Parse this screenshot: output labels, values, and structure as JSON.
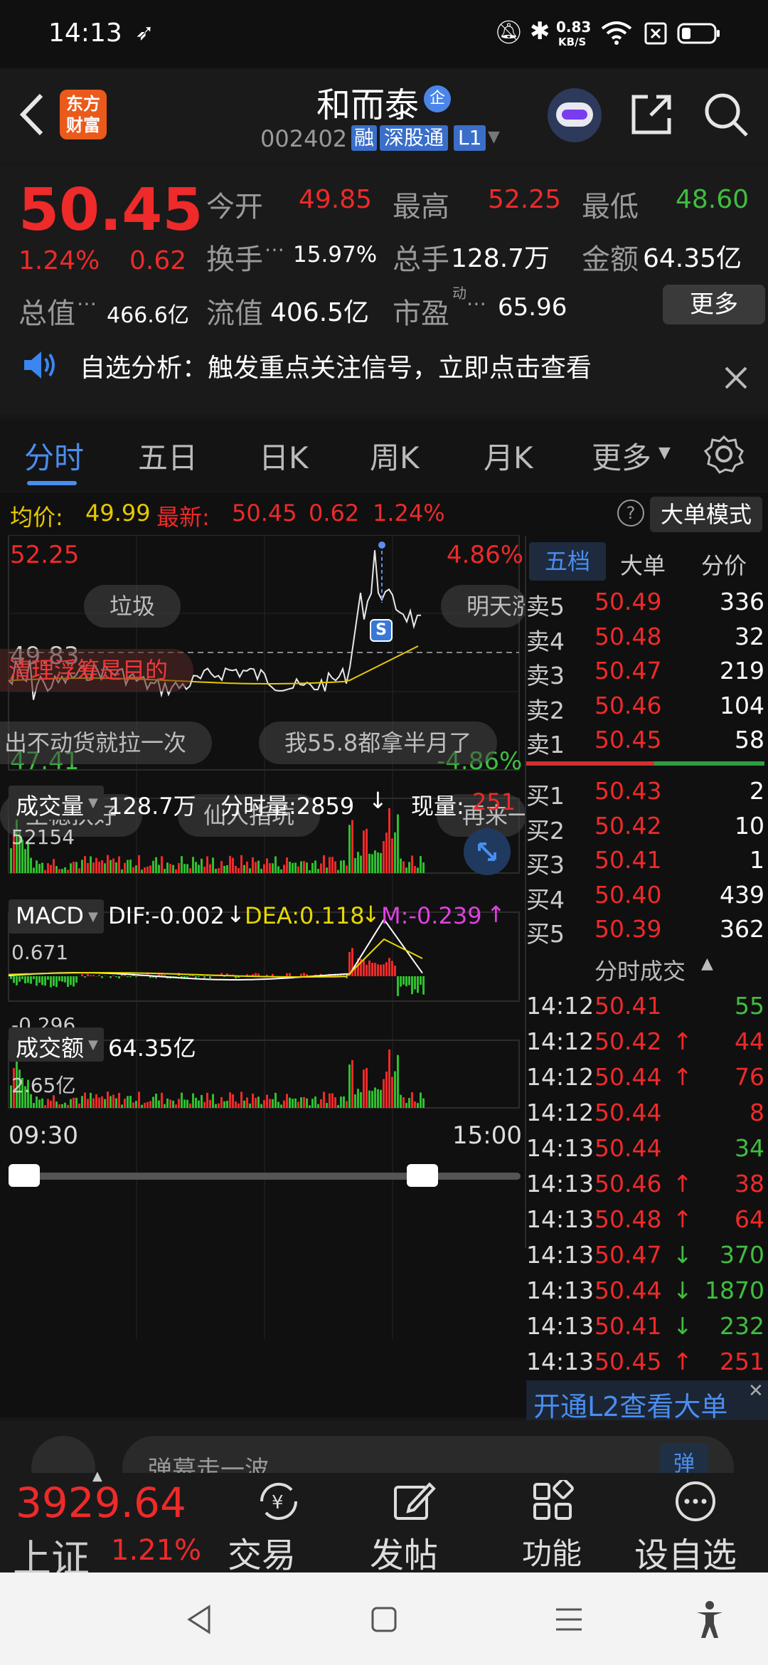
{
  "status": {
    "time": "14:13",
    "net_speed": "0.83",
    "net_unit": "KB/S"
  },
  "header": {
    "app_logo_line1": "东方",
    "app_logo_line2": "财富",
    "stock_name": "和而泰",
    "corp_badge": "企",
    "code": "002402",
    "tag_rong": "融",
    "tag_connect": "深股通",
    "tag_level": "L1"
  },
  "quote": {
    "price": "50.45",
    "change_pct": "1.24%",
    "change": "0.62",
    "open_label": "今开",
    "open": "49.85",
    "high_label": "最高",
    "high": "52.25",
    "low_label": "最低",
    "low": "48.60",
    "turnover_label": "换手",
    "turnover": "15.97%",
    "volume_label": "总手",
    "volume": "128.7万",
    "amount_label": "金额",
    "amount": "64.35亿",
    "mktcap_label": "总值",
    "mktcap": "466.6亿",
    "float_label": "流值",
    "float": "406.5亿",
    "pe_label": "市盈",
    "pe_sup": "动",
    "pe": "65.96",
    "more": "更多"
  },
  "notice": {
    "text": "自选分析：触发重点关注信号，立即点击查看"
  },
  "tabs": [
    "分时",
    "五日",
    "日K",
    "周K",
    "月K",
    "更多"
  ],
  "chart_header": {
    "avg_label": "均价:",
    "avg": "49.99",
    "last_label": "最新:",
    "last": "50.45",
    "change": "0.62",
    "pct": "1.24%",
    "mode_button": "大单模式"
  },
  "price_chart": {
    "y_top": "52.25",
    "y_top_pct": "4.86%",
    "y_mid": "49.83",
    "y_bot": "47.41",
    "y_bot_pct": "-4.86%",
    "marker": "S"
  },
  "comments": [
    "垃圾",
    "明天涨",
    "清理浮筹是目的",
    "出不动货就拉一次",
    "我55.8都拿半月了",
    "坐稳扶好",
    "仙人指坑",
    "再来一波"
  ],
  "volume_panel": {
    "label": "成交量",
    "total": "128.7万",
    "tick_label": "分时量:2859",
    "now_label": "现量:",
    "now_value": "251",
    "ymax": "52154"
  },
  "macd_panel": {
    "label": "MACD",
    "dif": "DIF:-0.002",
    "dea": "DEA:0.118",
    "m": "M:-0.239",
    "ymax": "0.671",
    "ymin": "-0.296"
  },
  "amount_panel": {
    "label": "成交额",
    "total": "64.35亿",
    "ymax": "2.65亿"
  },
  "time_axis": {
    "start": "09:30",
    "end": "15:00"
  },
  "orderbook_tabs": [
    "五档",
    "大单",
    "分价"
  ],
  "asks": [
    {
      "label": "卖5",
      "price": "50.49",
      "vol": "336"
    },
    {
      "label": "卖4",
      "price": "50.48",
      "vol": "32"
    },
    {
      "label": "卖3",
      "price": "50.47",
      "vol": "219"
    },
    {
      "label": "卖2",
      "price": "50.46",
      "vol": "104"
    },
    {
      "label": "卖1",
      "price": "50.45",
      "vol": "58"
    }
  ],
  "bids": [
    {
      "label": "买1",
      "price": "50.43",
      "vol": "2"
    },
    {
      "label": "买2",
      "price": "50.42",
      "vol": "10"
    },
    {
      "label": "买3",
      "price": "50.41",
      "vol": "1"
    },
    {
      "label": "买4",
      "price": "50.40",
      "vol": "439"
    },
    {
      "label": "买5",
      "price": "50.39",
      "vol": "362"
    }
  ],
  "trades_title": "分时成交",
  "trades": [
    {
      "time": "14:12",
      "price": "50.41",
      "dir": "",
      "vol": "55",
      "vol_color": "#3fbe3f"
    },
    {
      "time": "14:12",
      "price": "50.42",
      "dir": "↑",
      "vol": "44",
      "vol_color": "#ee2a2a"
    },
    {
      "time": "14:12",
      "price": "50.44",
      "dir": "↑",
      "vol": "76",
      "vol_color": "#ee2a2a"
    },
    {
      "time": "14:12",
      "price": "50.44",
      "dir": "",
      "vol": "8",
      "vol_color": "#ee2a2a"
    },
    {
      "time": "14:13",
      "price": "50.44",
      "dir": "",
      "vol": "34",
      "vol_color": "#3fbe3f"
    },
    {
      "time": "14:13",
      "price": "50.46",
      "dir": "↑",
      "vol": "38",
      "vol_color": "#ee2a2a"
    },
    {
      "time": "14:13",
      "price": "50.48",
      "dir": "↑",
      "vol": "64",
      "vol_color": "#ee2a2a"
    },
    {
      "time": "14:13",
      "price": "50.47",
      "dir": "↓",
      "vol": "370",
      "vol_color": "#3fbe3f"
    },
    {
      "time": "14:13",
      "price": "50.44",
      "dir": "↓",
      "vol": "1870",
      "vol_color": "#3fbe3f"
    },
    {
      "time": "14:13",
      "price": "50.41",
      "dir": "↓",
      "vol": "232",
      "vol_color": "#3fbe3f"
    },
    {
      "time": "14:13",
      "price": "50.45",
      "dir": "↑",
      "vol": "251",
      "vol_color": "#ee2a2a"
    }
  ],
  "l2_banner": "开通L2查看大单",
  "comment_input": {
    "placeholder": "弹幕走一波",
    "badge": "弹"
  },
  "bottom": {
    "index_value": "3929.64",
    "index_name": "上证",
    "index_pct": "1.21%",
    "trade": "交易",
    "post": "发帖",
    "func": "功能",
    "add": "设自选"
  },
  "colors": {
    "up": "#ee2a2a",
    "down": "#3fbe3f",
    "avg_line": "#e6c800",
    "accent": "#4a8df0"
  }
}
